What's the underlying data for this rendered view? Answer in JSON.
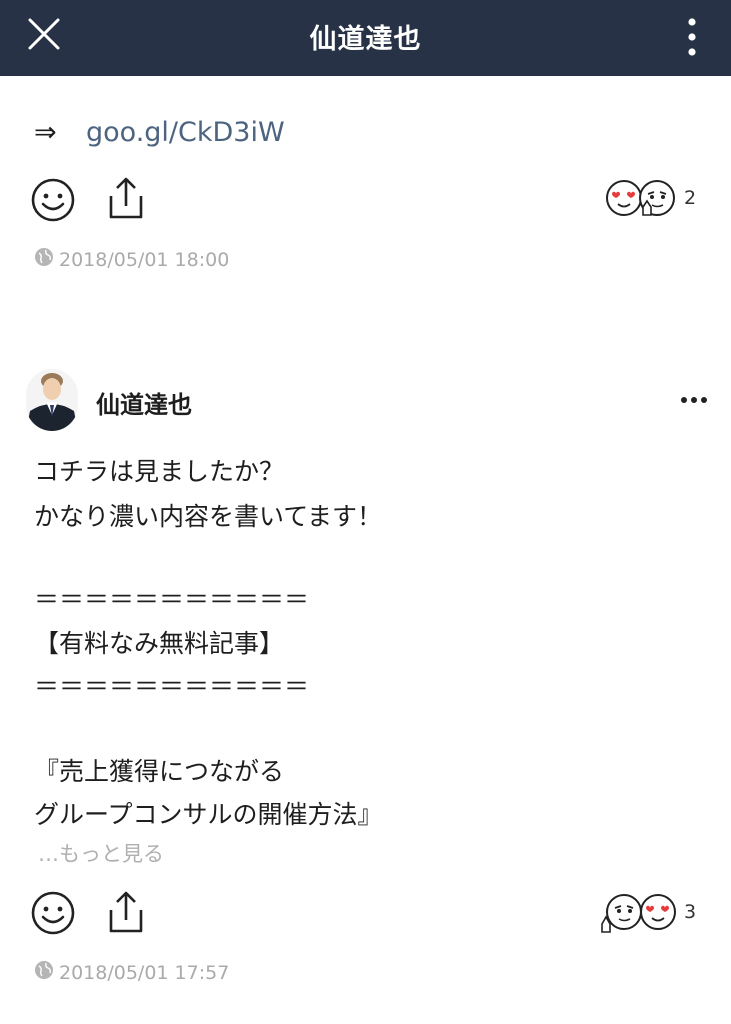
{
  "header": {
    "title": "仙道達也",
    "close_icon": "close-icon",
    "menu_icon": "vertical-dots-icon",
    "background": "#273246"
  },
  "post1": {
    "arrow": "⇒",
    "link": "goo.gl/CkD3iW",
    "reaction_count": "2",
    "timestamp": "2018/05/01 18:00"
  },
  "post2": {
    "author": "仙道達也",
    "lines": [
      "コチラは見ましたか？",
      "かなり濃い内容を書いてます！",
      "",
      "＝＝＝＝＝＝＝＝＝＝＝",
      "【有料なみ無料記事】",
      "＝＝＝＝＝＝＝＝＝＝＝",
      "",
      "『売上獲得につながる",
      "グループコンサルの開催方法』"
    ],
    "see_more": "…もっと見る",
    "reaction_count": "3",
    "timestamp": "2018/05/01 17:57"
  },
  "colors": {
    "link": "#4d6480",
    "muted": "#aaaaaa"
  }
}
